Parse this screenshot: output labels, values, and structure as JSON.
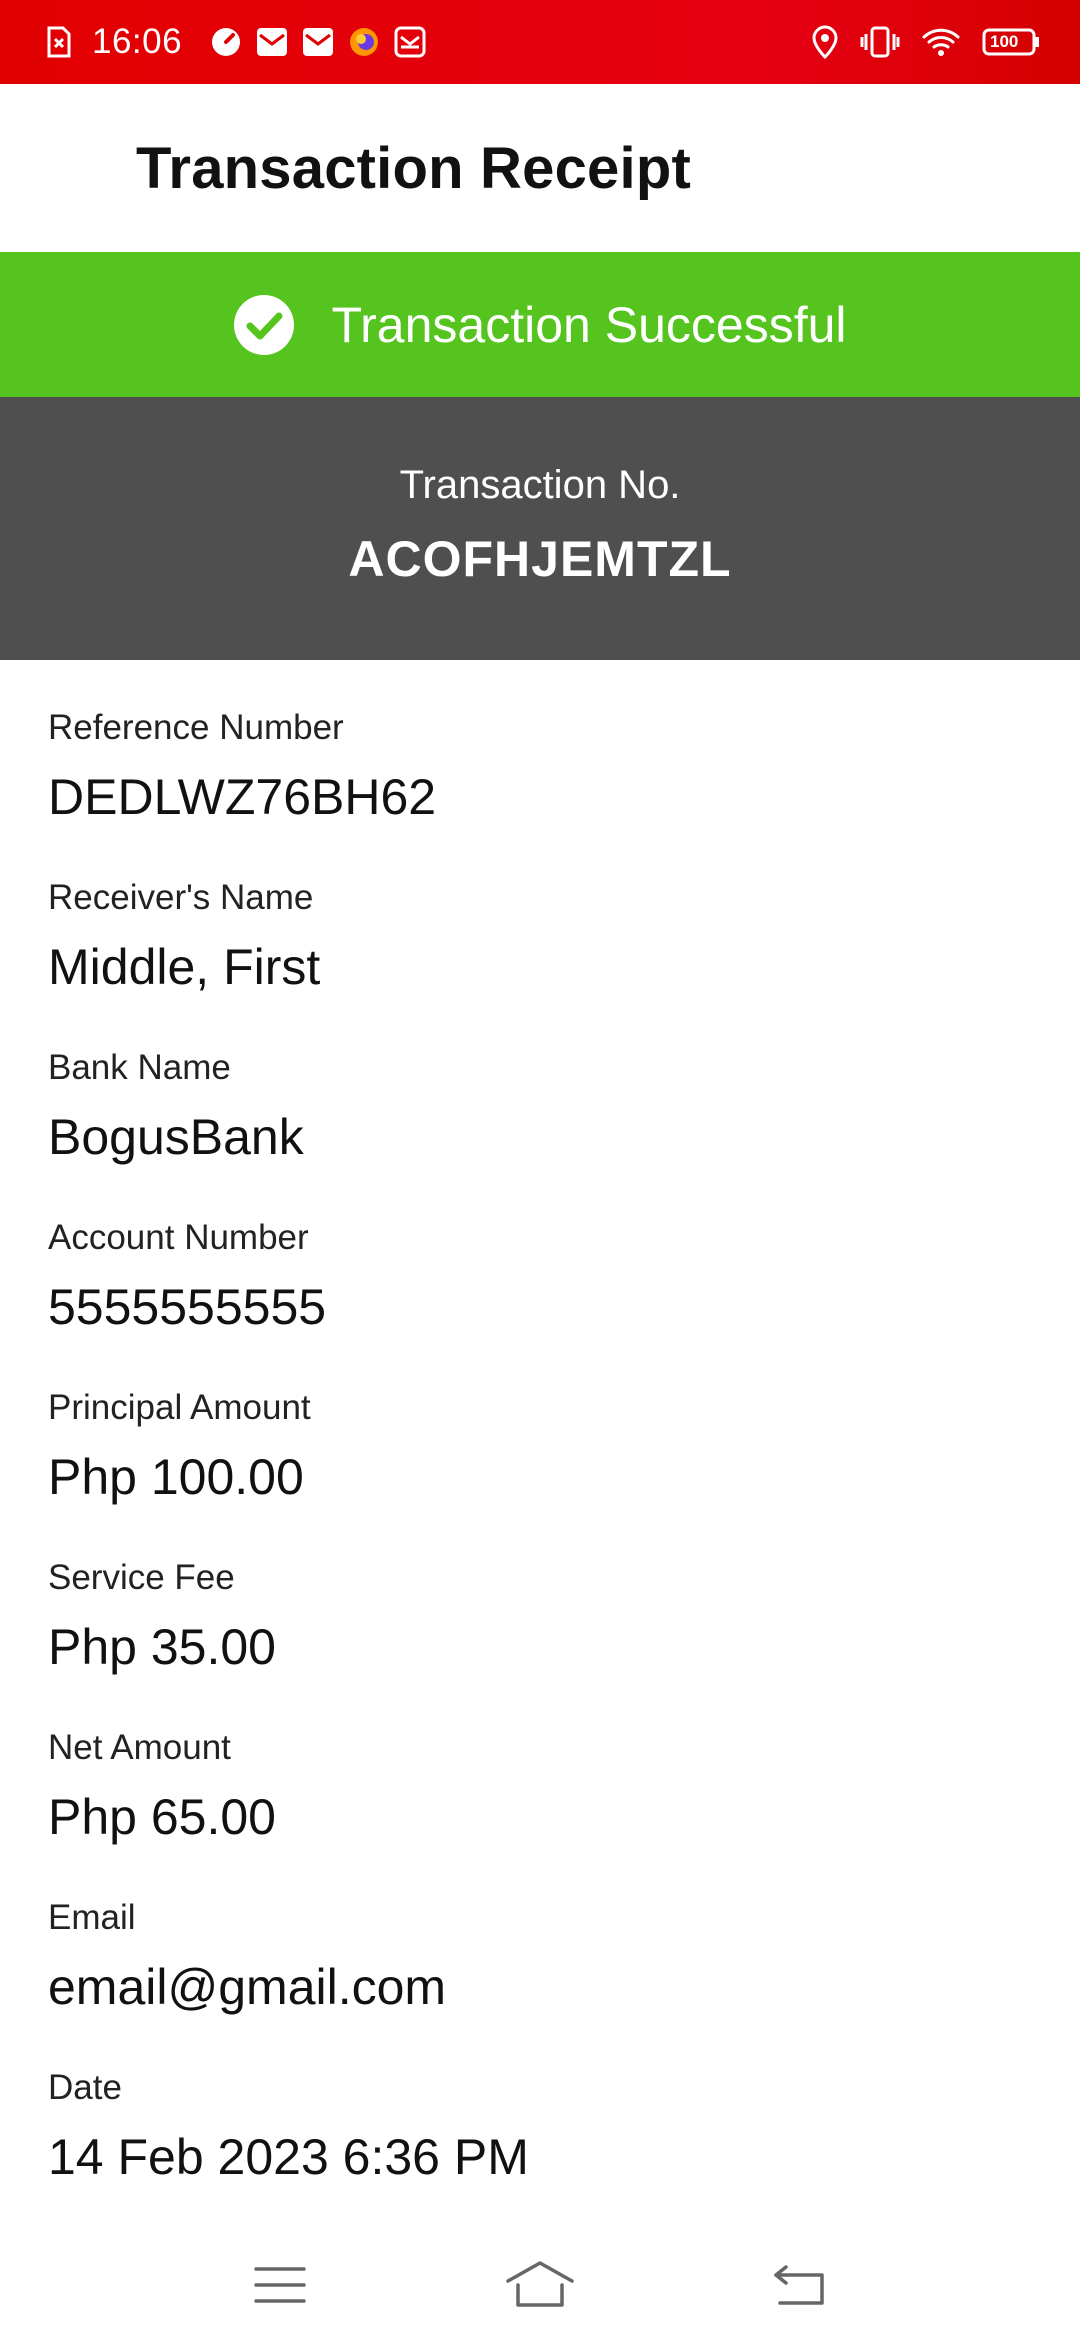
{
  "status_bar": {
    "time": "16:06",
    "battery": "100",
    "left_icons": [
      "sim-off-icon",
      "speedometer-icon",
      "mail-icon",
      "mail-icon",
      "firefox-icon",
      "inbox-icon"
    ],
    "right_icons": [
      "location-icon",
      "vibrate-icon",
      "wifi-icon",
      "battery-icon"
    ]
  },
  "header": {
    "title": "Transaction Receipt"
  },
  "banner": {
    "text": "Transaction Successful",
    "icon": "check-circle-icon",
    "color": "#55c41f"
  },
  "transaction": {
    "label": "Transaction No.",
    "value": "ACOFHJEMTZL"
  },
  "details": [
    {
      "label": "Reference Number",
      "value": "DEDLWZ76BH62"
    },
    {
      "label": "Receiver's Name",
      "value": "Middle, First"
    },
    {
      "label": "Bank Name",
      "value": "BogusBank"
    },
    {
      "label": "Account Number",
      "value": "5555555555"
    },
    {
      "label": "Principal Amount",
      "value": "Php 100.00"
    },
    {
      "label": "Service Fee",
      "value": "Php 35.00"
    },
    {
      "label": "Net Amount",
      "value": "Php 65.00"
    },
    {
      "label": "Email",
      "value": "email@gmail.com"
    },
    {
      "label": "Date",
      "value": "14 Feb 2023 6:36 PM"
    }
  ],
  "nav": {
    "icons": [
      "menu-icon",
      "home-icon",
      "back-icon"
    ]
  },
  "colors": {
    "status_bar": "#e10000",
    "success": "#55c41f",
    "panel": "#4f4f4f"
  }
}
